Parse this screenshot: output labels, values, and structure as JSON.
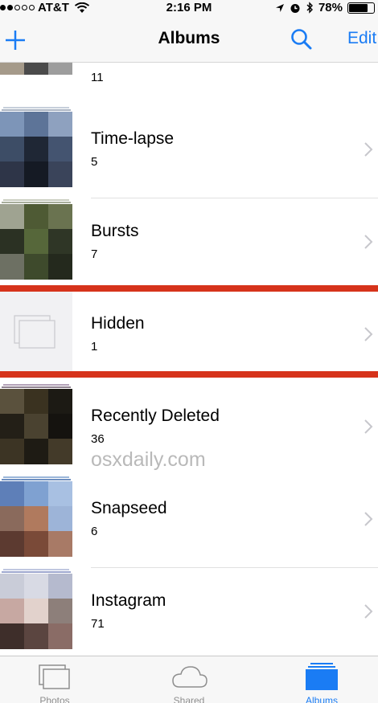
{
  "status_bar": {
    "carrier": "AT&T",
    "time": "2:16 PM",
    "battery": "78%",
    "battery_level": 0.78
  },
  "nav": {
    "title": "Albums",
    "edit_label": "Edit"
  },
  "albums": [
    {
      "name": "",
      "count": "11"
    },
    {
      "name": "Time-lapse",
      "count": "5"
    },
    {
      "name": "Bursts",
      "count": "7"
    },
    {
      "name": "Hidden",
      "count": "1"
    },
    {
      "name": "Recently Deleted",
      "count": "36"
    },
    {
      "name": "Snapseed",
      "count": "6"
    },
    {
      "name": "Instagram",
      "count": "71"
    }
  ],
  "watermark": "osxdaily.com",
  "tabs": [
    {
      "label": "Photos",
      "icon": "photos-tab-icon"
    },
    {
      "label": "Shared",
      "icon": "cloud-icon"
    },
    {
      "label": "Albums",
      "icon": "albums-tab-icon"
    }
  ],
  "colors": {
    "accent": "#1a7cf4",
    "highlight": "#d6331b"
  }
}
